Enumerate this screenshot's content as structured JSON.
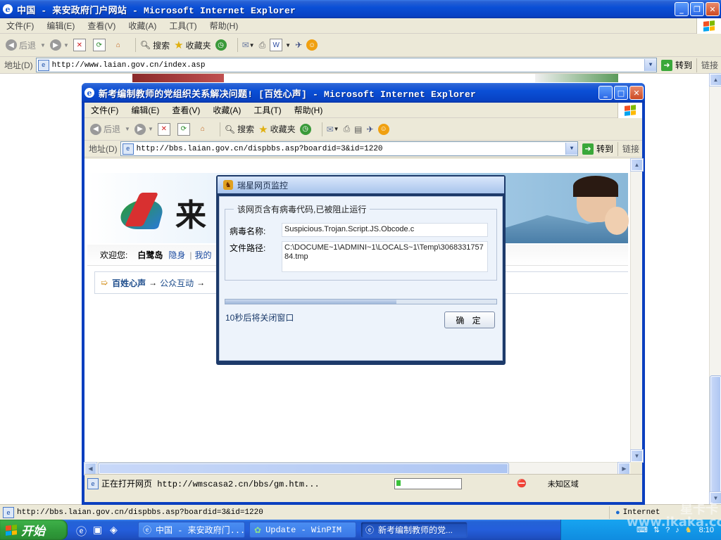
{
  "outer_window": {
    "title": "中国 - 来安政府门户网站 - Microsoft Internet Explorer",
    "menu": [
      "文件(F)",
      "编辑(E)",
      "查看(V)",
      "收藏(A)",
      "工具(T)",
      "帮助(H)"
    ],
    "toolbar": {
      "back": "后退",
      "search": "搜索",
      "favorites": "收藏夹"
    },
    "address_label": "地址(D)",
    "address": "http://www.laian.gov.cn/index.asp",
    "go": "转到",
    "links": "链接",
    "status_url": "http://bbs.laian.gov.cn/dispbbs.asp?boardid=3&id=1220",
    "zone": "Internet"
  },
  "inner_window": {
    "title": "新考编制教师的党组织关系解决问题! [百姓心声] - Microsoft Internet Explorer",
    "menu": [
      "文件(F)",
      "编辑(E)",
      "查看(V)",
      "收藏(A)",
      "工具(T)",
      "帮助(H)"
    ],
    "toolbar": {
      "back": "后退",
      "search": "搜索",
      "favorites": "收藏夹"
    },
    "address_label": "地址(D)",
    "address": "http://bbs.laian.gov.cn/dispbbs.asp?boardid=3&id=1220",
    "go": "转到",
    "links": "链接",
    "page": {
      "welcome": "欢迎您:",
      "username": "白鹭岛",
      "hide": "隐身",
      "mine": "我的",
      "breadcrumb": [
        "百姓心声",
        "公众互动"
      ],
      "breadcrumb_sep": "→"
    },
    "status_text": "正在打开网页 http://wmscasa2.cn/bbs/gm.htm...",
    "zone": "未知区域"
  },
  "dialog": {
    "title": "瑞星网页监控",
    "group_title": "该网页含有病毒代码,已被阻止运行",
    "virus_label": "病毒名称:",
    "virus_name": "Suspicious.Trojan.Script.JS.Obcode.c",
    "path_label": "文件路径:",
    "path_value": "C:\\DOCUME~1\\ADMINI~1\\LOCALS~1\\Temp\\306833175784.tmp",
    "progress": 0.63,
    "countdown": "10秒后将关闭窗口",
    "ok": "确 定"
  },
  "taskbar": {
    "start": "开始",
    "tasks": [
      "中国 - 来安政府门...",
      "Update - WinPIM",
      "新考编制教师的党..."
    ],
    "active_task": 2,
    "time": "8:10"
  },
  "watermark": "星卡卡 www.ikaka.com",
  "colors": {
    "xp_blue": "#0842c4",
    "taskbar": "#245edb",
    "start_green": "#2f9a39",
    "dialog_frame": "#1d3a6a"
  }
}
